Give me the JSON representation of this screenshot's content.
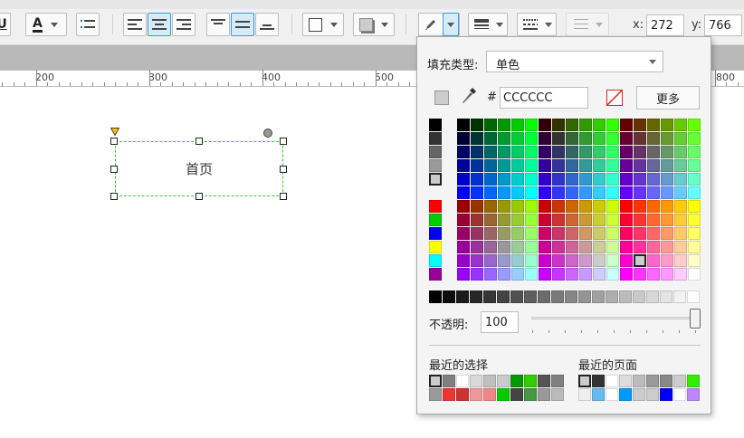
{
  "toolbar": {
    "underline_label": "U",
    "font_color_label": "A",
    "x_label": "x:",
    "x_value": "272",
    "y_label": "y:",
    "y_value": "766"
  },
  "ruler": {
    "labels": [
      "200",
      "300",
      "400",
      "500",
      "800"
    ]
  },
  "shape": {
    "text": "首页"
  },
  "fill_popup": {
    "fill_type_label": "填充类型:",
    "fill_type_value": "单色",
    "hash_label": "#",
    "hex_value": "CCCCCC",
    "more_button": "更多",
    "opacity_label": "不透明:",
    "opacity_value": "100",
    "opacity_level": 1.0,
    "recent_selection_label": "最近的选择",
    "recent_page_label": "最近的页面",
    "recent_selection_colors": [
      "#cccccc",
      "#808080",
      "#ffffff",
      "#d9d9d9",
      "#bfbfbf",
      "#cccccc",
      "#009900",
      "#33cc00",
      "#555555",
      "#808080",
      "#999999",
      "#ee3333",
      "#cc3333",
      "#ee9999",
      "#ee8888",
      "#00cc00",
      "#444444",
      "#449944",
      "#999999",
      "#bbbbbb"
    ],
    "recent_page_colors": [
      "#cccccc",
      "#333333",
      "#ffffff",
      "#dddddd",
      "#bbbbbb",
      "#999999",
      "#888888",
      "#cccccc",
      "#33ee00",
      "#eeeeee",
      "#66bbee",
      "#ffffff",
      "#0099ff",
      "#cccccc",
      "#cccccc",
      "#0000ff",
      "#ffffff",
      "#bb88ff"
    ]
  }
}
